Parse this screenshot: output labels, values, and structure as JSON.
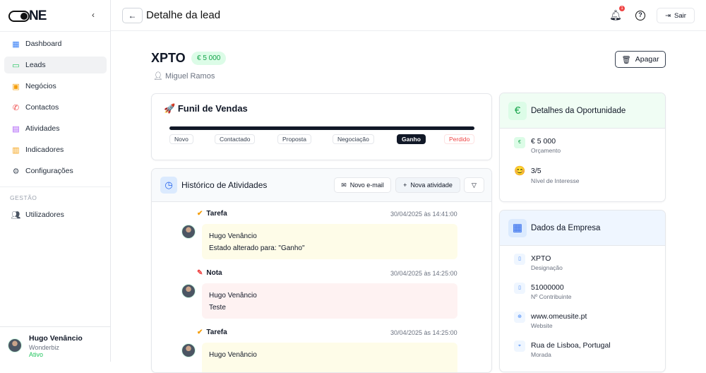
{
  "sidebar": {
    "logo": "ONE",
    "items": [
      {
        "label": "Dashboard",
        "icon": "dashboard-icon"
      },
      {
        "label": "Leads",
        "icon": "leads-icon"
      },
      {
        "label": "Negócios",
        "icon": "briefcase-icon"
      },
      {
        "label": "Contactos",
        "icon": "phone-icon"
      },
      {
        "label": "Atividades",
        "icon": "calendar-icon"
      },
      {
        "label": "Indicadores",
        "icon": "bar-chart-icon"
      },
      {
        "label": "Configurações",
        "icon": "gear-icon"
      }
    ],
    "section": "GESTÃO",
    "admin_item": "Utilizadores",
    "user": {
      "name": "Hugo Venâncio",
      "company": "Wonderbiz",
      "status": "Ativo"
    }
  },
  "header": {
    "title": "Detalhe da lead",
    "notifications": "1",
    "logout": "Sair"
  },
  "lead": {
    "name": "XPTO",
    "amount": "€ 5 000",
    "owner": "Miguel Ramos",
    "delete": "Apagar"
  },
  "funnel": {
    "title": "Funil de Vendas",
    "stages": [
      "Novo",
      "Contactado",
      "Proposta",
      "Negociação",
      "Ganho",
      "Perdido"
    ],
    "current": "Ganho"
  },
  "history": {
    "title": "Histórico de Atividades",
    "new_email": "Novo e-mail",
    "new_activity": "Nova atividade",
    "events": [
      {
        "type": "Tarefa",
        "date": "30/04/2025 às 14:41:00",
        "author": "Hugo Venâncio",
        "text": "Estado alterado para: \"Ganho\""
      },
      {
        "type": "Nota",
        "date": "30/04/2025 às 14:25:00",
        "author": "Hugo Venâncio",
        "text": "Teste"
      },
      {
        "type": "Tarefa",
        "date": "30/04/2025 às 14:25:00",
        "author": "Hugo Venâncio",
        "text": ""
      }
    ]
  },
  "opportunity": {
    "title": "Detalhes da Oportunidade",
    "budget": "€ 5 000",
    "budget_label": "Orçamento",
    "interest": "3/5",
    "interest_label": "Nível de Interesse"
  },
  "company": {
    "title": "Dados da Empresa",
    "rows": [
      {
        "value": "XPTO",
        "label": "Designação"
      },
      {
        "value": "51000000",
        "label": "Nº Contribuinte"
      },
      {
        "value": "www.omeusite.pt",
        "label": "Website"
      },
      {
        "value": "Rua de Lisboa, Portugal",
        "label": "Morada"
      }
    ]
  }
}
